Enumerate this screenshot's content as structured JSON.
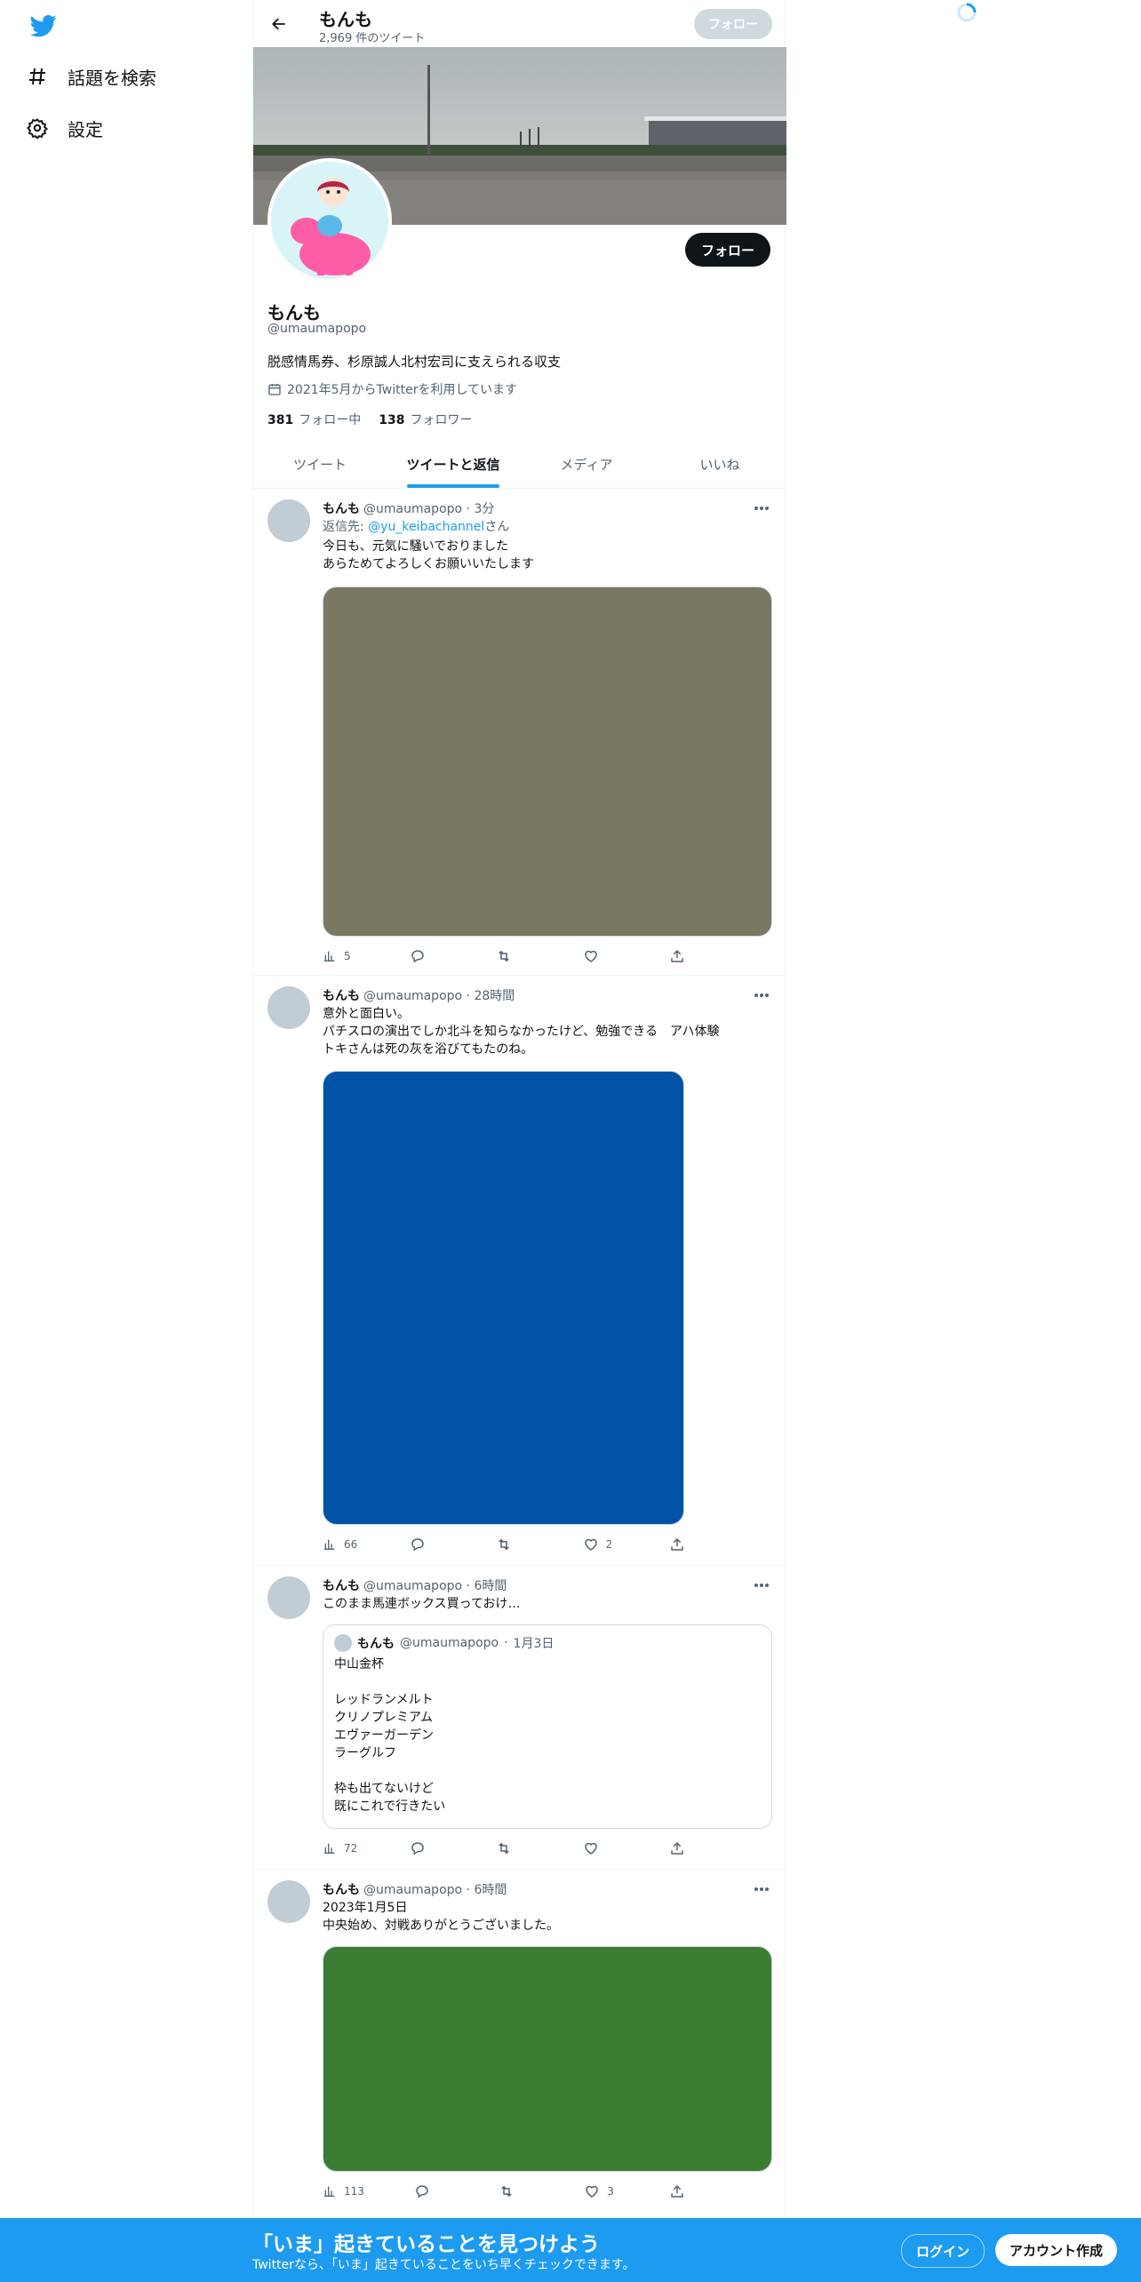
{
  "nav": {
    "items": [
      {
        "label": "話題を検索",
        "icon": "hashtag-icon"
      },
      {
        "label": "設定",
        "icon": "gear-icon"
      }
    ]
  },
  "topbar": {
    "title": "もんも",
    "tweet_count": "2,969 件のツイート",
    "follow_label": "フォロー"
  },
  "profile": {
    "name": "もんも",
    "handle": "@umaumapopo",
    "bio": "脱感情馬券、杉原誠人北村宏司に支えられる収支",
    "joined": "2021年5月からTwitterを利用しています",
    "following_count": "381",
    "following_label": "フォロー中",
    "followers_count": "138",
    "followers_label": "フォロワー",
    "follow_label": "フォロー"
  },
  "tabs": [
    "ツイート",
    "ツイートと返信",
    "メディア",
    "いいね"
  ],
  "tweets": [
    {
      "name": "もんも",
      "handle": "@umaumapopo",
      "time": "3分",
      "reply_prefix": "返信先: ",
      "reply_to": "@yu_keibachannel",
      "reply_suffix": "さん",
      "text": "今日も、元気に騒いでおりました\nあらためてよろしくお願いいたします",
      "media_color": "#7a7762",
      "views": "5",
      "replies": "",
      "retweets": "",
      "likes": ""
    },
    {
      "name": "もんも",
      "handle": "@umaumapopo",
      "time": "28時間",
      "text": "意外と面白い。\nパチスロの演出でしか北斗を知らなかったけど、勉強できる　アハ体験\nトキさんは死の灰を浴びてもたのね。",
      "media_color": "#0053a6",
      "views": "66",
      "replies": "",
      "retweets": "",
      "likes": "2"
    },
    {
      "name": "もんも",
      "handle": "@umaumapopo",
      "time": "6時間",
      "text": "このまま馬連ボックス買っておけ…",
      "quote": {
        "name": "もんも",
        "handle": "@umaumapopo",
        "time": "1月3日",
        "text": "中山金杯\n\nレッドランメルト\nクリノプレミアム\nエヴァーガーデン\nラーグルフ\n\n枠も出てないけど\n既にこれで行きたい"
      },
      "views": "72",
      "replies": "",
      "retweets": "",
      "likes": ""
    },
    {
      "name": "もんも",
      "handle": "@umaumapopo",
      "time": "6時間",
      "text": "2023年1月5日\n中央始め、対戦ありがとうございました。",
      "media_color": "#3a7d33",
      "views": "113",
      "replies": "",
      "retweets": "",
      "likes": "3"
    }
  ],
  "bottom_bar": {
    "title": "「いま」起きていることを見つけよう",
    "subtitle": "Twitterなら、「いま」起きていることをいち早くチェックできます。",
    "login_label": "ログイン",
    "signup_label": "アカウント作成"
  },
  "colors": {
    "accent": "#1d9bf0",
    "text": "#0f1419",
    "muted": "#536471"
  }
}
